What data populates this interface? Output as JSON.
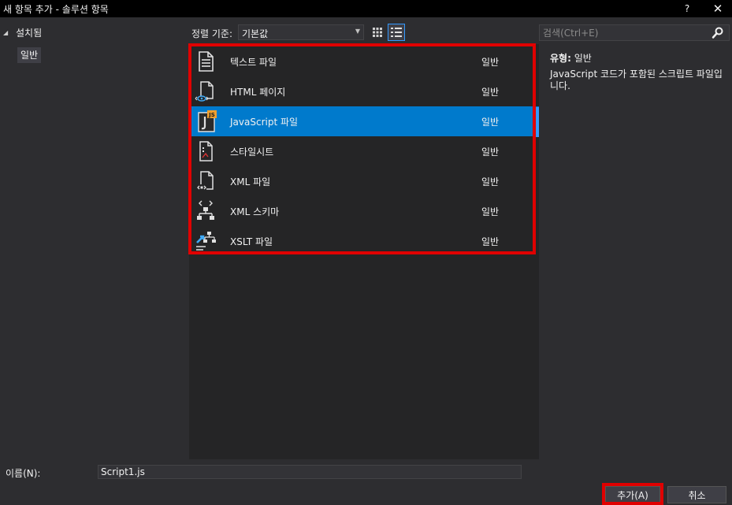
{
  "window": {
    "title": "새 항목 추가 - 솔루션 항목",
    "help_label": "?",
    "close_label": "✕"
  },
  "tree": {
    "root_label": "설치됨",
    "child_label": "일반"
  },
  "toolbar": {
    "sort_label": "정렬 기준:",
    "sort_value": "기본값"
  },
  "search": {
    "placeholder": "검색(Ctrl+E)"
  },
  "items": [
    {
      "name": "텍스트 파일",
      "category": "일반",
      "icon": "text-file-icon"
    },
    {
      "name": "HTML 페이지",
      "category": "일반",
      "icon": "html-page-icon"
    },
    {
      "name": "JavaScript 파일",
      "category": "일반",
      "icon": "javascript-file-icon",
      "selected": true
    },
    {
      "name": "스타일시트",
      "category": "일반",
      "icon": "stylesheet-icon"
    },
    {
      "name": "XML 파일",
      "category": "일반",
      "icon": "xml-file-icon"
    },
    {
      "name": "XML 스키마",
      "category": "일반",
      "icon": "xml-schema-icon"
    },
    {
      "name": "XSLT 파일",
      "category": "일반",
      "icon": "xslt-file-icon"
    }
  ],
  "details": {
    "type_label": "유형:",
    "type_value": "일반",
    "description": "JavaScript 코드가 포함된 스크립트 파일입니다."
  },
  "footer": {
    "name_label": "이름(N):",
    "name_value": "Script1.js",
    "add_label": "추가(A)",
    "cancel_label": "취소"
  },
  "colors": {
    "background": "#2d2d30",
    "list_background": "#252526",
    "selection": "#007acc",
    "highlight": "#e00000",
    "title_bar": "#000000"
  }
}
